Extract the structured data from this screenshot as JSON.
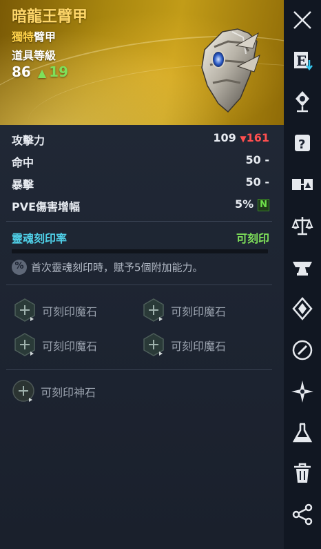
{
  "item": {
    "name": "暗龍王臂甲",
    "rarity": "獨特",
    "type": "臂甲",
    "level_label": "道具等級",
    "level": "86",
    "level_up": "19"
  },
  "stats": [
    {
      "name": "攻擊力",
      "value": "109",
      "change": "161",
      "change_dir": "down"
    },
    {
      "name": "命中",
      "value": "50 -"
    },
    {
      "name": "暴擊",
      "value": "50 -"
    },
    {
      "name": "PVE傷害增幅",
      "value": "5%",
      "badge": "N"
    }
  ],
  "soul": {
    "label": "靈魂刻印率",
    "status": "可刻印",
    "note": "首次靈魂刻印時，賦予5個附加能力。",
    "progress": 0
  },
  "sockets": {
    "magic_label": "可刻印魔石",
    "divine_label": "可刻印神石"
  },
  "sidebar": {
    "items": [
      "close-icon",
      "equip-icon",
      "upgrade-icon",
      "scroll-icon",
      "compare-icon",
      "balance-icon",
      "anvil-icon",
      "enchant-icon",
      "link-icon",
      "star-icon",
      "flask-icon",
      "trash-icon",
      "share-icon"
    ]
  },
  "colors": {
    "title": "#ffd76a",
    "soul": "#4fd0e8",
    "green": "#7ee05a",
    "red": "#ff4f4f"
  }
}
